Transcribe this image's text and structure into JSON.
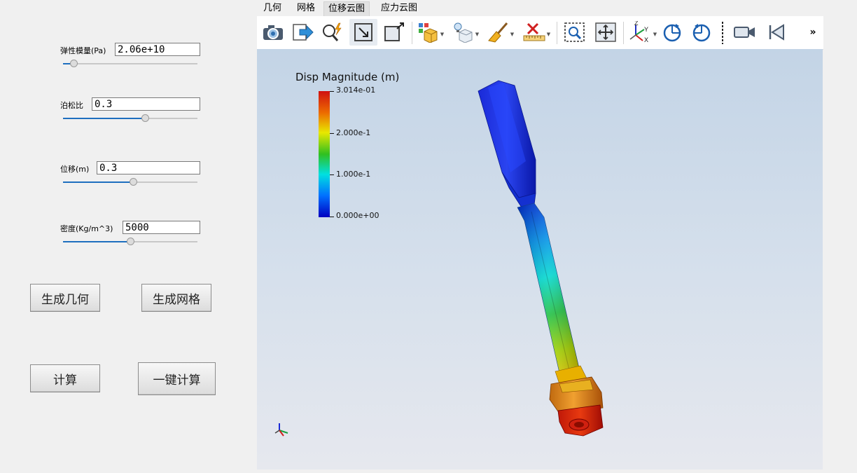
{
  "params": [
    {
      "label": "弹性模量(Pa)",
      "value": "2.06e+10",
      "slider": 0.08
    },
    {
      "label": "泊松比",
      "value": "0.3",
      "slider": 0.61
    },
    {
      "label": "位移(m)",
      "value": "0.3",
      "slider": 0.52
    },
    {
      "label": "密度(Kg/m^3)",
      "value": "5000",
      "slider": 0.5
    }
  ],
  "buttons": {
    "gen_geometry": "生成几何",
    "gen_mesh": "生成网格",
    "compute": "计算",
    "one_click": "一键计算"
  },
  "menu": [
    "几何",
    "网格",
    "位移云图",
    "应力云图"
  ],
  "menu_active": "位移云图",
  "toolbar": {
    "overflow": "»",
    "icons": [
      "camera-icon",
      "export-icon",
      "query-icon",
      "zoom-to-box-icon",
      "reset-view-icon",
      "cube-colors-icon",
      "light-cube-icon",
      "clear-broom-icon",
      "ruler-delete-icon",
      "select-zoom-icon",
      "fit-view-icon",
      "axes-orient-icon",
      "rotate-cw-icon",
      "rotate-ccw-icon",
      "video-camera-icon",
      "first-frame-icon"
    ]
  },
  "legend": {
    "title": "Disp Magnitude (m)",
    "ticks": [
      "3.014e-01",
      "2.000e-1",
      "1.000e-1",
      "0.000e+00"
    ],
    "colors": [
      "#d01010",
      "#e87800",
      "#e8e800",
      "#30c020",
      "#00e0e0",
      "#0040ff",
      "#0000c0"
    ]
  },
  "axes_labels": {
    "x": "X",
    "y": "Y",
    "z": "Z"
  }
}
